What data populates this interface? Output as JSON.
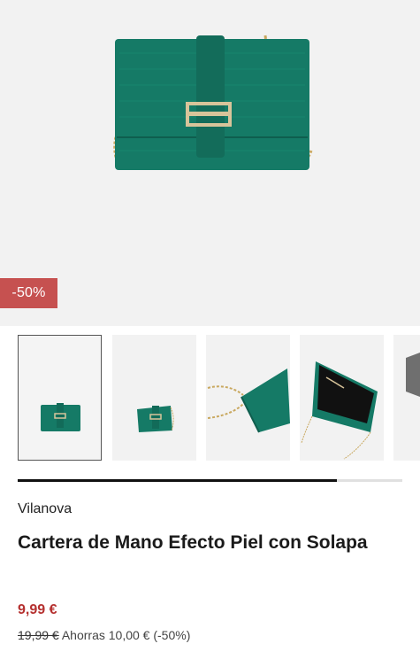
{
  "product": {
    "discount_badge": "-50%",
    "brand": "Vilanova",
    "title": "Cartera de Mano Efecto Piel con Solapa",
    "price": "9,99 €",
    "old_price": "19,99 €",
    "savings": "Ahorras 10,00 € (-50%)"
  },
  "gallery": {
    "thumbnail_count_visible": 5,
    "selected_index": 0,
    "scroll_progress": 0.83
  },
  "colors": {
    "bag_green": "#157a66",
    "badge_red": "#c65150",
    "price_red": "#b5302f",
    "chain_gold": "#c9a85f"
  },
  "icons": {
    "hero": "product-image-green-clutch",
    "thumb_1": "clutch-front-icon",
    "thumb_2": "clutch-angle-icon",
    "thumb_3": "clutch-side-chain-icon",
    "thumb_4": "clutch-open-interior-icon",
    "thumb_5": "next-image-peek-icon"
  }
}
